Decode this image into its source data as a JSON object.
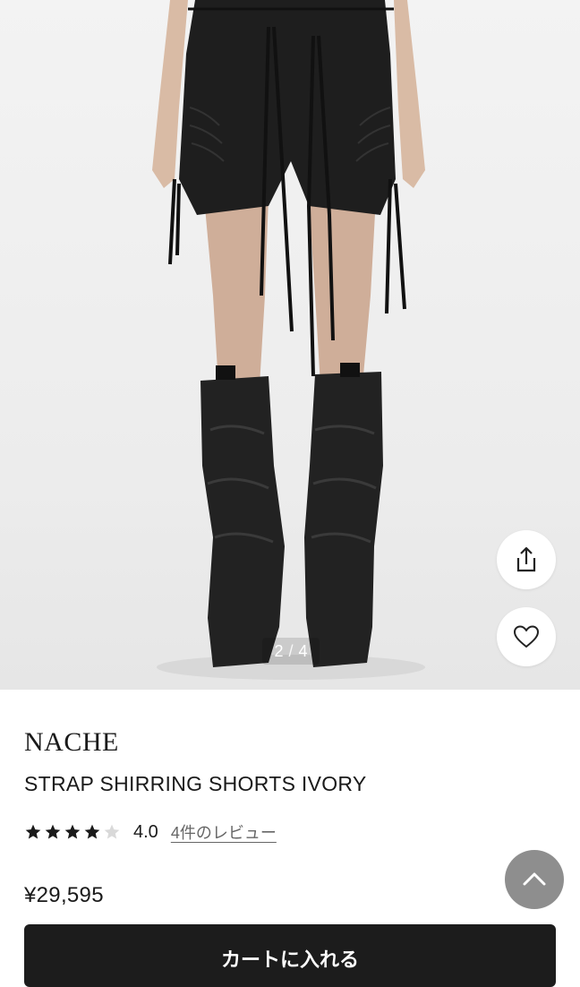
{
  "gallery": {
    "current_page": "2",
    "separator": "/",
    "total_pages": "4",
    "share_icon": "share-icon",
    "favorite_icon": "heart-icon"
  },
  "product": {
    "brand": "NACHE",
    "name": "STRAP SHIRRING SHORTS IVORY",
    "rating": 4.0,
    "rating_label": "4.0",
    "review_link": "4件のレビュー",
    "price": "¥29,595"
  },
  "actions": {
    "add_to_cart": "カートに入れる",
    "scroll_top_icon": "chevron-up-icon"
  },
  "colors": {
    "star_filled": "#1a1a1a",
    "star_empty": "#d9d9d9",
    "cart_button": "#1c1c1c",
    "scroll_top": "#8e8e8e"
  }
}
